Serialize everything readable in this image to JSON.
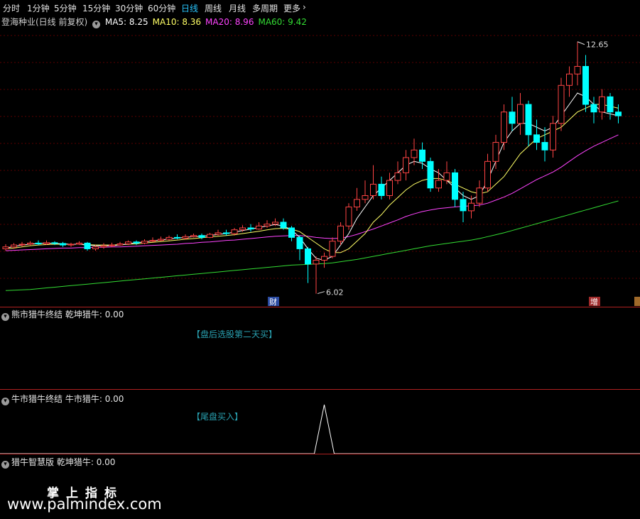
{
  "tabs": [
    {
      "label": "分时"
    },
    {
      "label": "1分钟"
    },
    {
      "label": "5分钟"
    },
    {
      "label": "15分钟"
    },
    {
      "label": "30分钟"
    },
    {
      "label": "60分钟"
    },
    {
      "label": "日线",
      "active": true
    },
    {
      "label": "周线"
    },
    {
      "label": "月线"
    },
    {
      "label": "多周期"
    },
    {
      "label": "更多"
    }
  ],
  "main": {
    "title": "登海种业(日线 前复权)",
    "ma_labels": [
      {
        "text": "MA5: 8.25",
        "color": "#ffffff"
      },
      {
        "text": "MA10: 8.36",
        "color": "#ffff66"
      },
      {
        "text": "MA20: 8.96",
        "color": "#ff44ff"
      },
      {
        "text": "MA60: 9.42",
        "color": "#33dd33"
      }
    ],
    "high_label": "12.65",
    "low_label": "6.02",
    "badge_left": "财",
    "badge_right": "增"
  },
  "panels": [
    {
      "title": "熊市猎牛终结",
      "indicator": "乾坤猎牛: 0.00",
      "note": "【盘后选股第二天买】"
    },
    {
      "title": "牛市猎牛终结",
      "indicator": "牛市猎牛: 0.00",
      "note": "【尾盘买入】"
    },
    {
      "title": "猎牛智慧版",
      "indicator": "乾坤猎牛: 0.00"
    }
  ],
  "watermark": {
    "line1": "掌上指标",
    "line2": "www.palmindex.com"
  },
  "colors": {
    "up": "#ff4444",
    "down": "#00ffff",
    "ma5": "#ffffff",
    "ma10": "#ffff66",
    "ma20": "#ff44ff",
    "ma60": "#33dd33",
    "grid": "#5a0000"
  },
  "chart_data": {
    "type": "candlestick",
    "y_range": [
      5.9,
      13.0
    ],
    "candles": [
      [
        7.2,
        7.25,
        7.32,
        7.15
      ],
      [
        7.25,
        7.3,
        7.35,
        7.2
      ],
      [
        7.3,
        7.32,
        7.38,
        7.25
      ],
      [
        7.32,
        7.35,
        7.4,
        7.28
      ],
      [
        7.35,
        7.33,
        7.42,
        7.3
      ],
      [
        7.33,
        7.36,
        7.42,
        7.3
      ],
      [
        7.36,
        7.34,
        7.4,
        7.3
      ],
      [
        7.34,
        7.3,
        7.38,
        7.25
      ],
      [
        7.3,
        7.32,
        7.36,
        7.25
      ],
      [
        7.32,
        7.35,
        7.4,
        7.3
      ],
      [
        7.35,
        7.2,
        7.38,
        7.15
      ],
      [
        7.2,
        7.25,
        7.3,
        7.15
      ],
      [
        7.25,
        7.28,
        7.35,
        7.2
      ],
      [
        7.28,
        7.3,
        7.36,
        7.24
      ],
      [
        7.3,
        7.33,
        7.38,
        7.28
      ],
      [
        7.33,
        7.38,
        7.42,
        7.3
      ],
      [
        7.38,
        7.35,
        7.42,
        7.3
      ],
      [
        7.35,
        7.4,
        7.45,
        7.32
      ],
      [
        7.4,
        7.42,
        7.5,
        7.38
      ],
      [
        7.42,
        7.45,
        7.52,
        7.4
      ],
      [
        7.45,
        7.5,
        7.55,
        7.42
      ],
      [
        7.5,
        7.48,
        7.58,
        7.45
      ],
      [
        7.48,
        7.52,
        7.58,
        7.44
      ],
      [
        7.52,
        7.55,
        7.6,
        7.5
      ],
      [
        7.55,
        7.5,
        7.6,
        7.45
      ],
      [
        7.5,
        7.58,
        7.62,
        7.48
      ],
      [
        7.58,
        7.62,
        7.7,
        7.55
      ],
      [
        7.62,
        7.6,
        7.7,
        7.55
      ],
      [
        7.6,
        7.7,
        7.75,
        7.55
      ],
      [
        7.7,
        7.75,
        7.82,
        7.65
      ],
      [
        7.75,
        7.72,
        7.85,
        7.65
      ],
      [
        7.72,
        7.8,
        7.9,
        7.7
      ],
      [
        7.8,
        7.85,
        7.95,
        7.75
      ],
      [
        7.85,
        7.9,
        8.0,
        7.8
      ],
      [
        7.9,
        7.75,
        8.0,
        7.7
      ],
      [
        7.75,
        7.5,
        7.8,
        7.4
      ],
      [
        7.5,
        7.2,
        7.55,
        6.9
      ],
      [
        7.2,
        6.8,
        7.25,
        6.3
      ],
      [
        6.8,
        6.9,
        7.0,
        6.02
      ],
      [
        6.9,
        7.0,
        7.1,
        6.7
      ],
      [
        7.0,
        7.4,
        7.5,
        6.95
      ],
      [
        7.4,
        7.8,
        7.9,
        7.3
      ],
      [
        7.8,
        8.3,
        8.4,
        7.7
      ],
      [
        8.3,
        8.5,
        8.8,
        8.2
      ],
      [
        8.5,
        8.6,
        9.0,
        8.4
      ],
      [
        8.6,
        8.9,
        9.4,
        8.5
      ],
      [
        8.9,
        8.6,
        9.1,
        8.5
      ],
      [
        8.6,
        9.0,
        9.2,
        8.5
      ],
      [
        9.0,
        9.2,
        9.5,
        8.9
      ],
      [
        9.2,
        9.6,
        9.8,
        9.0
      ],
      [
        9.6,
        9.8,
        10.1,
        9.4
      ],
      [
        9.8,
        9.5,
        10.0,
        9.3
      ],
      [
        9.5,
        8.8,
        9.6,
        8.7
      ],
      [
        8.8,
        9.0,
        9.3,
        8.7
      ],
      [
        9.0,
        9.2,
        9.5,
        8.9
      ],
      [
        9.2,
        8.5,
        9.3,
        8.3
      ],
      [
        8.5,
        8.2,
        8.7,
        7.9
      ],
      [
        8.2,
        8.4,
        8.6,
        8.0
      ],
      [
        8.4,
        8.8,
        9.0,
        8.3
      ],
      [
        8.8,
        9.5,
        9.7,
        8.7
      ],
      [
        9.5,
        10.0,
        10.2,
        9.3
      ],
      [
        10.0,
        10.8,
        11.0,
        9.8
      ],
      [
        10.8,
        10.5,
        11.2,
        10.3
      ],
      [
        10.5,
        11.0,
        11.3,
        10.2
      ],
      [
        11.0,
        10.2,
        11.1,
        9.9
      ],
      [
        10.2,
        10.0,
        10.6,
        9.8
      ],
      [
        10.0,
        9.8,
        10.4,
        9.5
      ],
      [
        9.8,
        10.5,
        10.7,
        9.6
      ],
      [
        10.5,
        11.5,
        11.7,
        10.3
      ],
      [
        11.5,
        11.8,
        12.0,
        11.2
      ],
      [
        11.8,
        12.0,
        12.65,
        11.5
      ],
      [
        12.0,
        11.0,
        12.3,
        10.8
      ],
      [
        11.0,
        10.8,
        11.2,
        10.5
      ],
      [
        10.8,
        11.2,
        11.4,
        10.6
      ],
      [
        11.2,
        10.8,
        11.3,
        10.6
      ],
      [
        10.8,
        10.7,
        11.0,
        10.5
      ]
    ],
    "ma5": [
      7.22,
      7.26,
      7.3,
      7.32,
      7.34,
      7.35,
      7.34,
      7.33,
      7.32,
      7.32,
      7.3,
      7.28,
      7.28,
      7.28,
      7.3,
      7.33,
      7.36,
      7.38,
      7.41,
      7.43,
      7.46,
      7.48,
      7.5,
      7.52,
      7.53,
      7.55,
      7.58,
      7.6,
      7.64,
      7.68,
      7.72,
      7.76,
      7.8,
      7.84,
      7.8,
      7.7,
      7.5,
      7.2,
      6.95,
      6.9,
      7.0,
      7.3,
      7.6,
      8.0,
      8.3,
      8.6,
      8.8,
      9.0,
      9.2,
      9.4,
      9.5,
      9.45,
      9.3,
      9.2,
      9.0,
      8.8,
      8.6,
      8.5,
      8.6,
      9.0,
      9.5,
      10.0,
      10.3,
      10.5,
      10.5,
      10.4,
      10.3,
      10.4,
      10.7,
      11.0,
      11.3,
      11.2,
      11.0,
      10.8,
      10.75,
      10.7
    ],
    "ma10": [
      7.2,
      7.22,
      7.25,
      7.28,
      7.3,
      7.31,
      7.32,
      7.32,
      7.32,
      7.32,
      7.31,
      7.3,
      7.3,
      7.3,
      7.31,
      7.32,
      7.33,
      7.35,
      7.37,
      7.39,
      7.41,
      7.43,
      7.45,
      7.47,
      7.49,
      7.51,
      7.53,
      7.55,
      7.57,
      7.6,
      7.63,
      7.66,
      7.7,
      7.73,
      7.74,
      7.72,
      7.65,
      7.5,
      7.35,
      7.2,
      7.1,
      7.1,
      7.2,
      7.4,
      7.6,
      7.9,
      8.1,
      8.35,
      8.55,
      8.75,
      8.9,
      9.0,
      9.05,
      9.05,
      9.0,
      8.9,
      8.8,
      8.7,
      8.65,
      8.7,
      8.9,
      9.1,
      9.4,
      9.7,
      9.9,
      10.1,
      10.2,
      10.3,
      10.4,
      10.6,
      10.8,
      10.9,
      11.0,
      11.0,
      10.95,
      10.9
    ],
    "ma20": [
      7.15,
      7.16,
      7.17,
      7.18,
      7.19,
      7.2,
      7.21,
      7.22,
      7.22,
      7.23,
      7.23,
      7.24,
      7.24,
      7.25,
      7.25,
      7.26,
      7.27,
      7.28,
      7.29,
      7.3,
      7.31,
      7.32,
      7.34,
      7.35,
      7.37,
      7.38,
      7.4,
      7.42,
      7.43,
      7.45,
      7.47,
      7.49,
      7.51,
      7.53,
      7.54,
      7.55,
      7.55,
      7.53,
      7.5,
      7.48,
      7.47,
      7.48,
      7.52,
      7.58,
      7.65,
      7.72,
      7.8,
      7.88,
      7.96,
      8.05,
      8.12,
      8.18,
      8.22,
      8.26,
      8.28,
      8.3,
      8.32,
      8.33,
      8.35,
      8.4,
      8.48,
      8.56,
      8.66,
      8.78,
      8.9,
      9.02,
      9.12,
      9.22,
      9.35,
      9.5,
      9.65,
      9.78,
      9.9,
      10.0,
      10.1,
      10.2
    ],
    "ma60": [
      6.1,
      6.11,
      6.12,
      6.13,
      6.15,
      6.17,
      6.19,
      6.21,
      6.23,
      6.25,
      6.27,
      6.29,
      6.31,
      6.33,
      6.35,
      6.37,
      6.39,
      6.41,
      6.43,
      6.45,
      6.47,
      6.49,
      6.51,
      6.53,
      6.55,
      6.57,
      6.59,
      6.61,
      6.63,
      6.65,
      6.67,
      6.69,
      6.71,
      6.73,
      6.75,
      6.77,
      6.78,
      6.79,
      6.8,
      6.81,
      6.83,
      6.86,
      6.89,
      6.92,
      6.96,
      7.0,
      7.04,
      7.08,
      7.12,
      7.16,
      7.2,
      7.24,
      7.28,
      7.31,
      7.34,
      7.37,
      7.4,
      7.43,
      7.47,
      7.52,
      7.57,
      7.62,
      7.68,
      7.74,
      7.8,
      7.86,
      7.92,
      7.98,
      8.04,
      8.1,
      8.16,
      8.22,
      8.28,
      8.34,
      8.4,
      8.46
    ],
    "signal_panel2": {
      "peak_index": 39,
      "value_range": [
        0,
        1
      ]
    }
  }
}
